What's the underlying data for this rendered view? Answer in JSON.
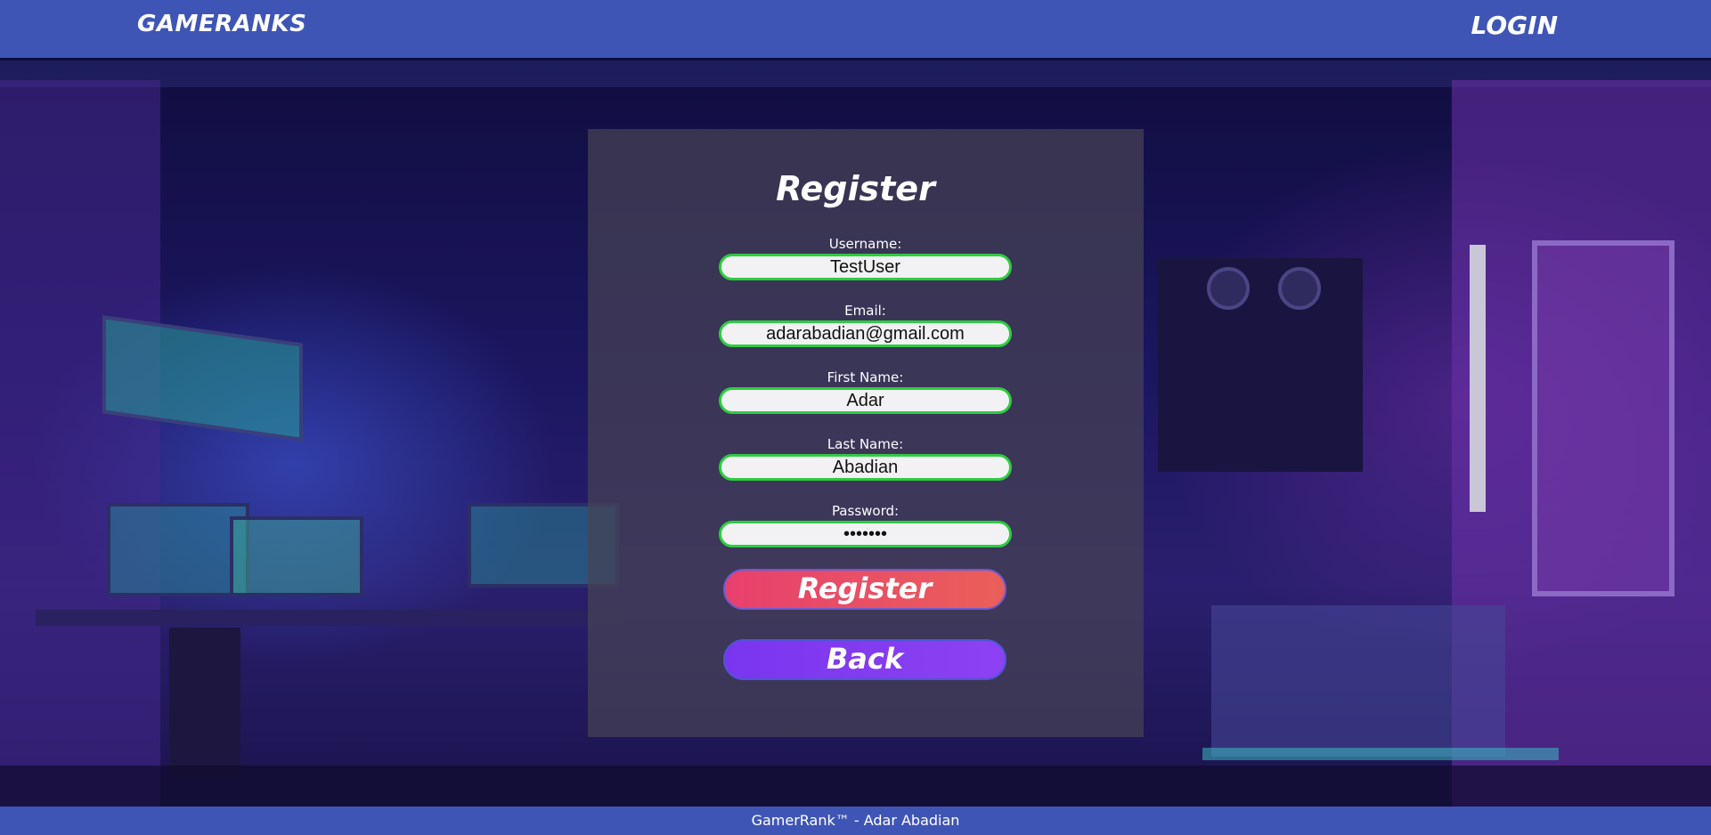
{
  "header": {
    "brand": "GAMERANKS",
    "login_link": "LOGIN"
  },
  "form": {
    "title": "Register",
    "fields": [
      {
        "label": "Username:",
        "value": "TestUser"
      },
      {
        "label": "Email:",
        "value": "adarabadian@gmail.com"
      },
      {
        "label": "First Name:",
        "value": "Adar"
      },
      {
        "label": "Last Name:",
        "value": "Abadian"
      },
      {
        "label": "Password:",
        "value": "•••••••"
      }
    ],
    "register_button": "Register",
    "back_button": "Back"
  },
  "footer": {
    "text": "GamerRank™ - Adar Abadian"
  },
  "colors": {
    "header_bg": "#3f55b5",
    "input_border": "#2ecc40",
    "register_btn": "#e8406e",
    "back_btn": "#7a35ef"
  }
}
